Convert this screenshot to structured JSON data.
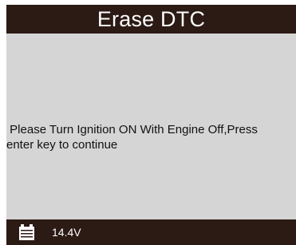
{
  "header": {
    "title": "Erase DTC"
  },
  "main": {
    "message": " Please Turn Ignition ON With Engine Off,Press\nenter key to continue"
  },
  "status_bar": {
    "battery_icon": "battery-icon",
    "voltage": "14.4V"
  },
  "colors": {
    "bar_background": "#2c1a14",
    "content_background": "#d5d5d5",
    "text_light": "#ffffff",
    "text_dark": "#111111"
  }
}
